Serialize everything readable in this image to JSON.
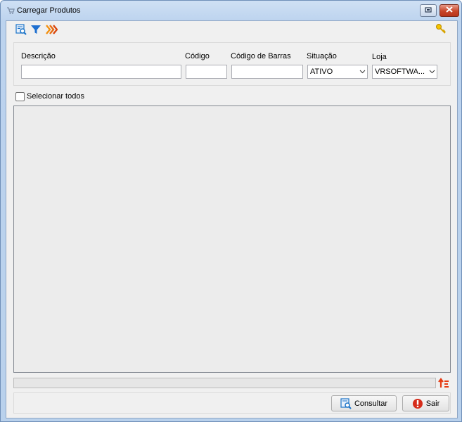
{
  "window": {
    "title": "Carregar Produtos"
  },
  "filters": {
    "descricao": {
      "label": "Descrição",
      "value": ""
    },
    "codigo": {
      "label": "Código",
      "value": ""
    },
    "codigo_barras": {
      "label": "Código de Barras",
      "value": ""
    },
    "situacao": {
      "label": "Situação",
      "selected": "ATIVO"
    },
    "loja": {
      "label": "Loja",
      "selected": "VRSOFTWA..."
    }
  },
  "select_all": {
    "label": "Selecionar todos",
    "checked": false
  },
  "progress": {
    "value": 0
  },
  "buttons": {
    "consultar": "Consultar",
    "sair": "Sair"
  },
  "colors": {
    "accent_blue": "#1a73c8",
    "filter_icon": "#1e6fd0",
    "arrows_icon": "#f29111",
    "close_red": "#c84528",
    "exit_red": "#d62c1a"
  },
  "icons": [
    "app-icon",
    "search-list-icon",
    "filter-icon",
    "forward-arrows-icon",
    "key-icon",
    "sort-icon",
    "consult-icon",
    "exit-icon",
    "restore-icon",
    "close-icon",
    "chevron-down-icon"
  ]
}
